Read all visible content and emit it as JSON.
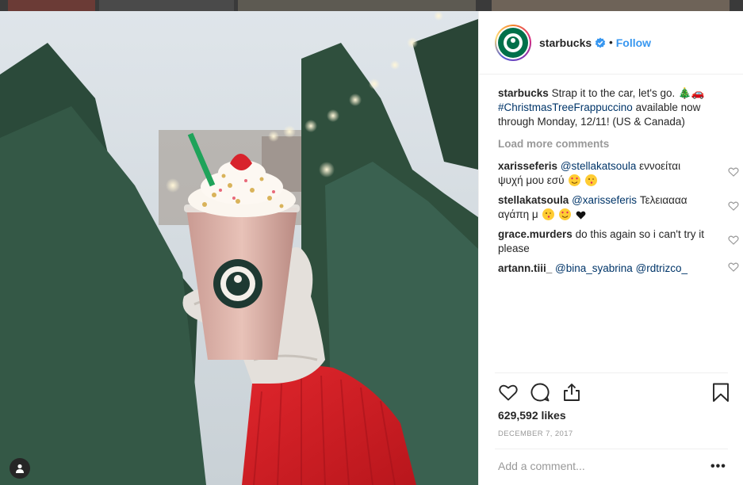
{
  "post": {
    "username": "starbucks",
    "follow_label": "Follow",
    "separator": "•",
    "caption": {
      "username": "starbucks",
      "text_1": "Strap it to the car, let's go. 🎄🚗",
      "hashtag": "#ChristmasTreeFrappuccino",
      "text_2": "available now through Monday, 12/11! (US & Canada)"
    },
    "load_more_label": "Load more comments",
    "comments": [
      {
        "username": "xarisseferis",
        "mention": "@stellakatsoula",
        "text": "εννοείται ψυχή μου εσύ"
      },
      {
        "username": "stellakatsoula",
        "mention": "@xarisseferis",
        "text": "Τελειαααα αγάπη μ"
      },
      {
        "username": "grace.murders",
        "text": "do this again so i can't try it please"
      },
      {
        "username": "artann.tiii_",
        "mention_1": "@bina_syabrina",
        "mention_2": "@rdtrizco_"
      }
    ],
    "likes": "629,592 likes",
    "date": "DECEMBER 7, 2017",
    "add_comment_placeholder": "Add a comment...",
    "more_options": "•••"
  },
  "icons": {
    "like": "heart-icon",
    "comment": "comment-bubble-icon",
    "share": "share-icon",
    "save": "bookmark-icon",
    "verified": "verified-badge-icon",
    "user_tag": "user-tag-icon"
  },
  "colors": {
    "link_blue": "#3897f0",
    "hashtag_navy": "#003569",
    "muted": "#999999",
    "text": "#262626"
  }
}
